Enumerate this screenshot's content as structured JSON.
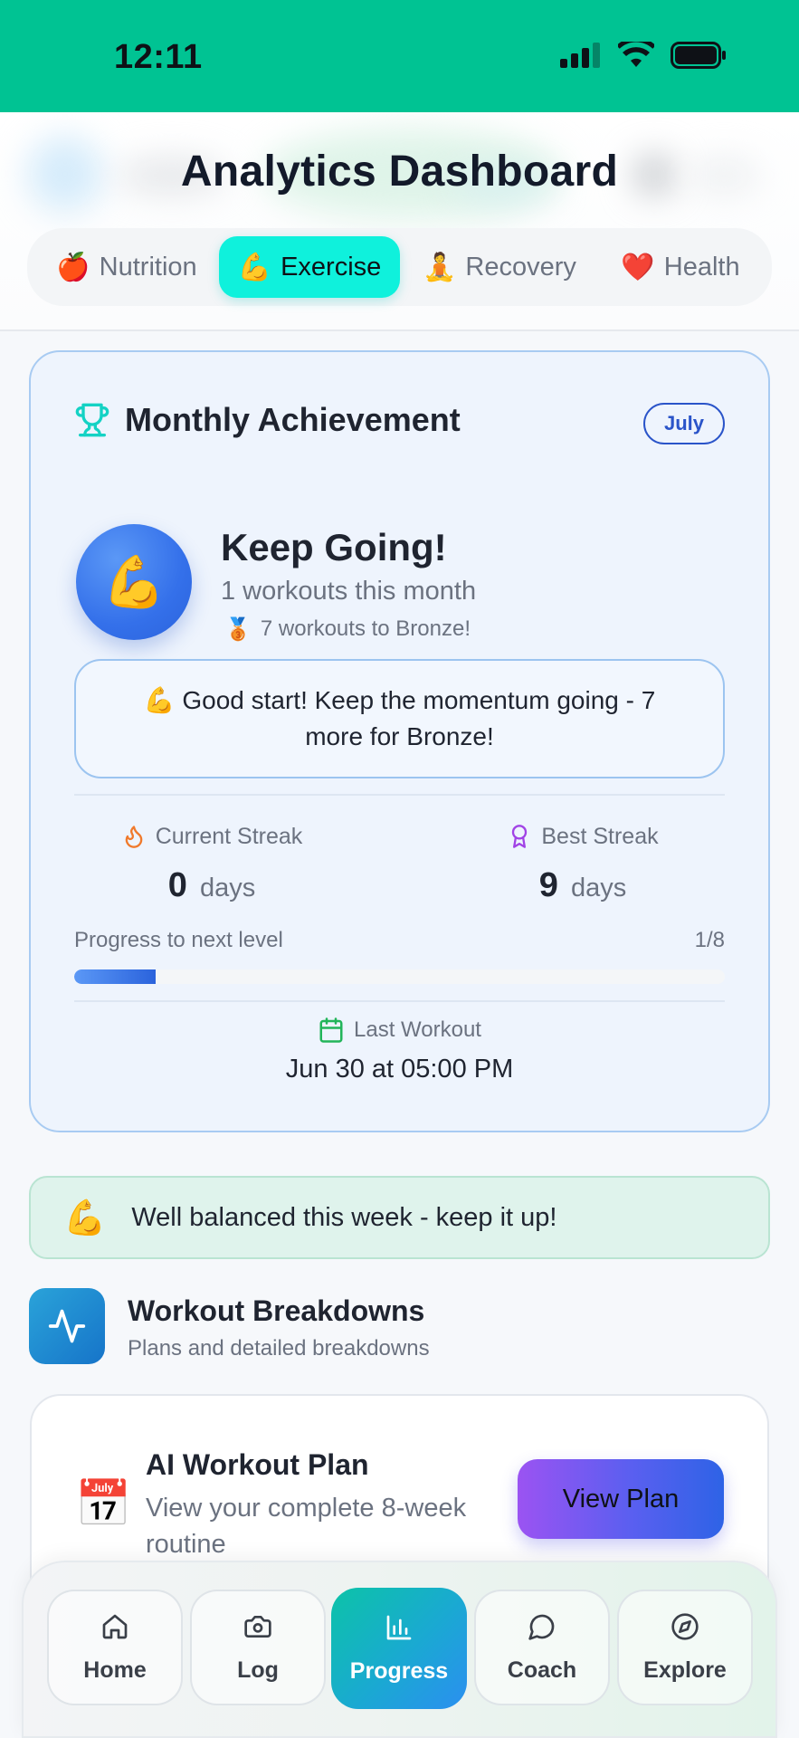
{
  "status_bar": {
    "time": "12:11",
    "color": "#00c393"
  },
  "header": {
    "title": "Analytics Dashboard",
    "tabs": [
      {
        "icon": "🍎",
        "label": "Nutrition",
        "active": false
      },
      {
        "icon": "💪",
        "label": "Exercise",
        "active": true
      },
      {
        "icon": "🧘",
        "label": "Recovery",
        "active": false
      },
      {
        "icon": "❤️",
        "label": "Health",
        "active": false
      }
    ]
  },
  "achievement": {
    "title": "Monthly Achievement",
    "month": "July",
    "avatar_emoji": "💪",
    "headline": "Keep Going!",
    "workouts_text": "1 workouts this month",
    "medal_emoji": "🥉",
    "next_level_text": "7 workouts to Bronze!",
    "motivation": "💪 Good start! Keep the momentum going - 7 more for Bronze!",
    "current_streak": {
      "label": "Current Streak",
      "value": "0",
      "unit": "days"
    },
    "best_streak": {
      "label": "Best Streak",
      "value": "9",
      "unit": "days"
    },
    "progress": {
      "label": "Progress to next level",
      "count": "1/8",
      "fraction": 0.125
    },
    "last_workout": {
      "label": "Last Workout",
      "value": "Jun 30 at 05:00 PM"
    }
  },
  "balance_banner": {
    "emoji": "💪",
    "text": "Well balanced this week - keep it up!"
  },
  "breakdowns": {
    "title": "Workout Breakdowns",
    "subtitle": "Plans and detailed breakdowns"
  },
  "plan_card": {
    "emoji": "📅",
    "title": "AI Workout Plan",
    "subtitle": "View your complete 8-week routine",
    "button": "View Plan"
  },
  "bottom_nav": {
    "items": [
      {
        "label": "Home",
        "icon": "home-icon"
      },
      {
        "label": "Log",
        "icon": "camera-icon"
      },
      {
        "label": "Progress",
        "icon": "bar-chart-icon",
        "active": true
      },
      {
        "label": "Coach",
        "icon": "chat-bubble-icon"
      },
      {
        "label": "Explore",
        "icon": "compass-icon"
      }
    ]
  }
}
